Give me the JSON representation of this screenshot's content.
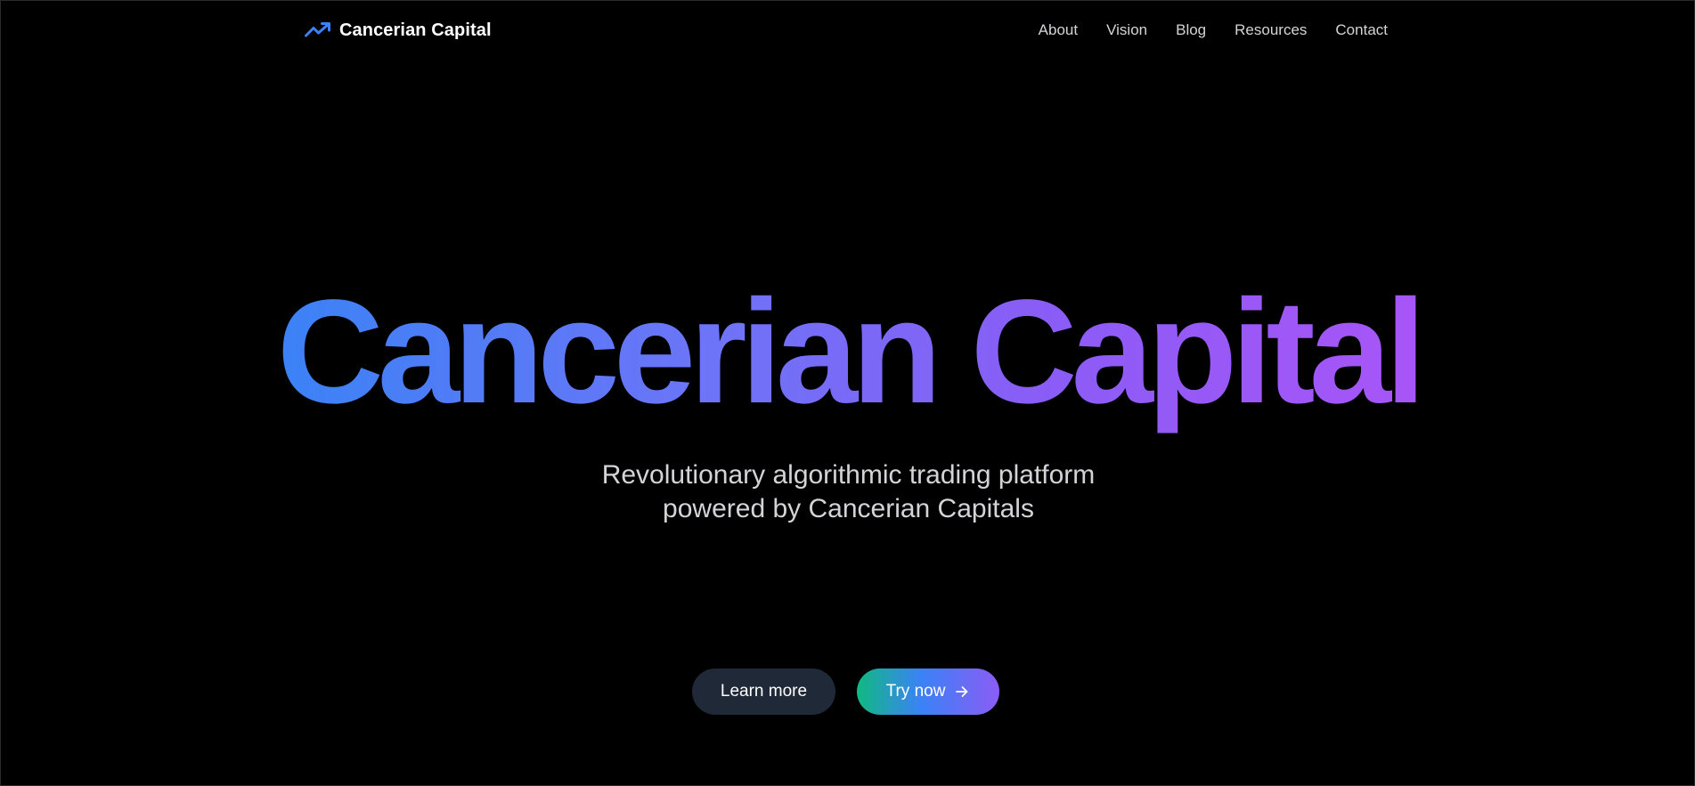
{
  "brand": {
    "name": "Cancerian Capital",
    "icon": "trending-up-icon",
    "icon_color": "#3b82f6"
  },
  "nav": {
    "links": [
      "About",
      "Vision",
      "Blog",
      "Resources",
      "Contact"
    ]
  },
  "hero": {
    "title": "Cancerian Capital",
    "subtitle_line1": "Revolutionary algorithmic trading platform",
    "subtitle_line2": "powered by Cancerian Capitals",
    "title_gradient": [
      "#3b82f6",
      "#a855f7"
    ]
  },
  "actions": {
    "learn_more": "Learn more",
    "try_now": "Try now",
    "try_now_icon": "arrow-right-icon",
    "try_now_gradient": [
      "#10b981",
      "#3b82f6",
      "#8b5cf6"
    ]
  },
  "colors": {
    "background": "#000000",
    "text_muted": "#d4d4d8",
    "secondary_button": "#1f2937"
  }
}
